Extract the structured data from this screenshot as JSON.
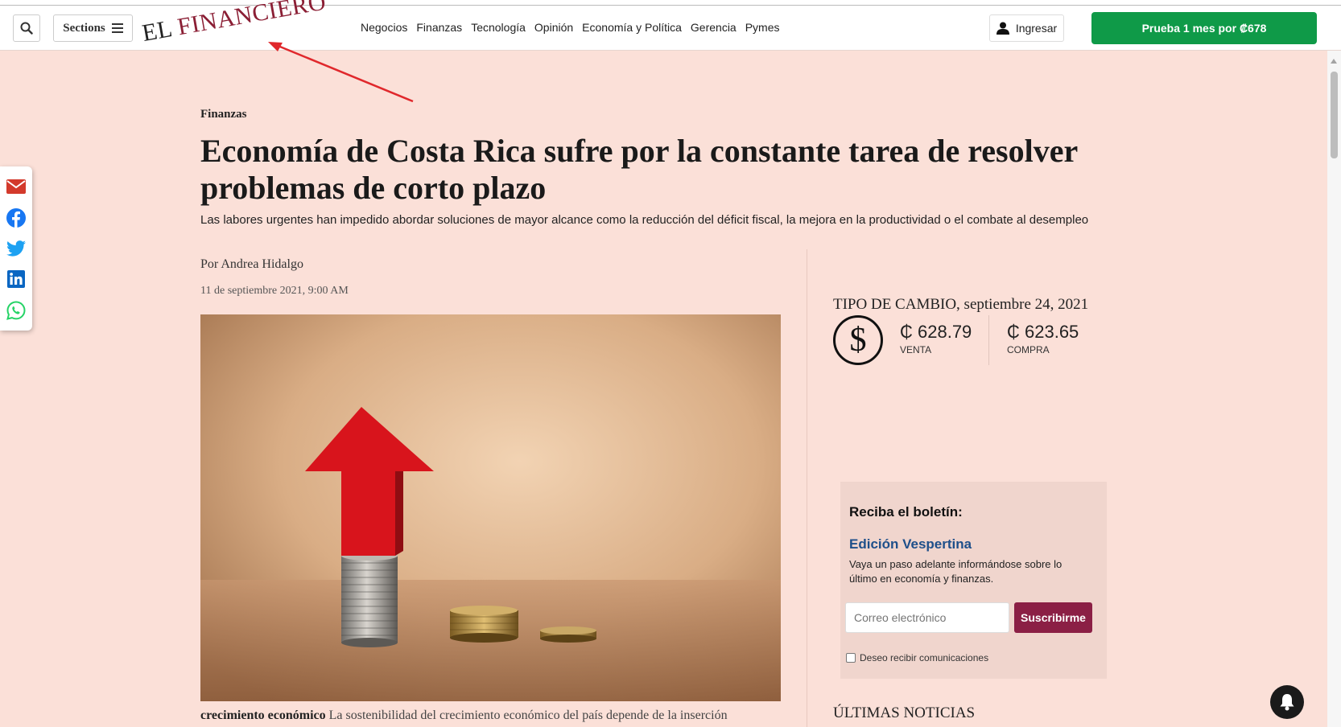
{
  "header": {
    "sections_label": "Sections",
    "logo_el": "EL",
    "logo_name": "FINANCIERO",
    "nav": [
      "Negocios",
      "Finanzas",
      "Tecnología",
      "Opinión",
      "Economía y Política",
      "Gerencia",
      "Pymes"
    ],
    "login_label": "Ingresar",
    "trial_label": "Prueba 1 mes por ₡678"
  },
  "article": {
    "section": "Finanzas",
    "headline": "Economía de Costa Rica sufre por la constante tarea de resolver problemas de corto plazo",
    "dek": "Las labores urgentes han impedido abordar soluciones de mayor alcance como la reducción del déficit fiscal, la mejora en la productividad o el combate al desempleo",
    "byline": "Por Andrea Hidalgo",
    "date": "11 de septiembre 2021, 9:00 AM",
    "caption_bold": "crecimiento económico",
    "caption_text": "La sostenibilidad del crecimiento económico del país depende de la inserción"
  },
  "exchange": {
    "title": "TIPO DE CAMBIO, septiembre 24, 2021",
    "sell_value": "₵ 628.79",
    "sell_label": "VENTA",
    "buy_value": "₵ 623.65",
    "buy_label": "COMPRA"
  },
  "newsletter": {
    "title": "Reciba el boletín:",
    "name": "Edición Vespertina",
    "description": "Vaya un paso adelante informándose sobre lo último en economía y finanzas.",
    "email_placeholder": "Correo electrónico",
    "subscribe_label": "Suscribirme",
    "consent_label": "Deseo recibir comunicaciones"
  },
  "latest_title": "ÚLTIMAS NOTICIAS",
  "colors": {
    "page_bg": "#fbe0d8",
    "brand": "#8b1f35",
    "cta_green": "#0f9a48",
    "annotation_red": "#e0282c"
  }
}
